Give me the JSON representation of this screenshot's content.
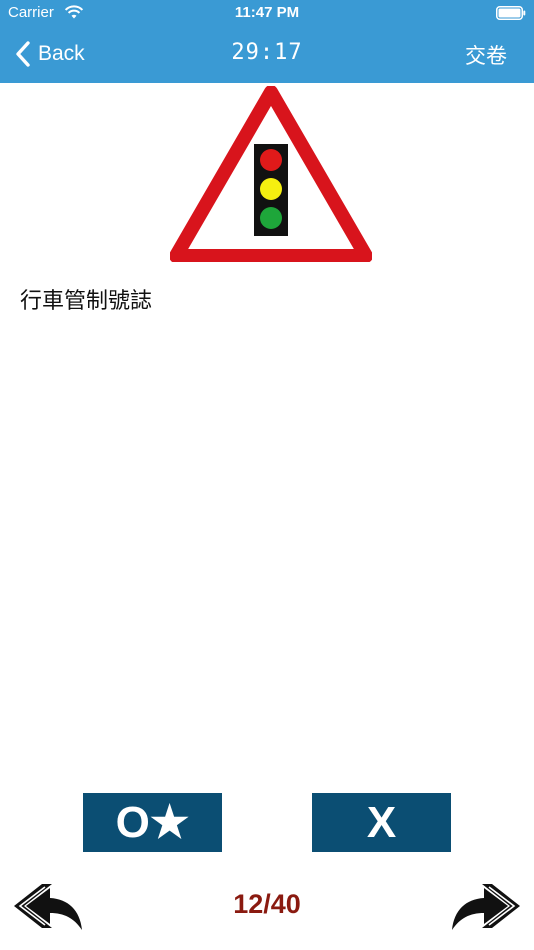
{
  "status_bar": {
    "carrier": "Carrier",
    "time": "11:47 PM"
  },
  "nav_bar": {
    "back_label": "Back",
    "timer": "29:17",
    "submit_label": "交卷"
  },
  "question": {
    "text": "行車管制號誌",
    "image_icon": "traffic-light-warning-sign"
  },
  "answers": {
    "true_label": "O★",
    "false_label": "X"
  },
  "pager": {
    "current": "12",
    "total": "40",
    "label": "12/40"
  },
  "colors": {
    "header_bg": "#3a9ad4",
    "answer_bg": "#0b4e73",
    "pager_text": "#8a1a10",
    "sign_red": "#d8141c",
    "light_red": "#e01a1a",
    "light_yellow": "#f5ef10",
    "light_green": "#1ea63a"
  }
}
